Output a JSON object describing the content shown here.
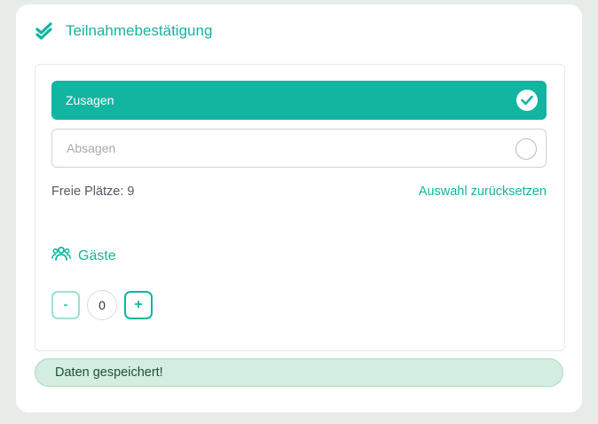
{
  "header": {
    "title": "Teilnahmebestätigung",
    "icon": "double-check-icon"
  },
  "options": {
    "accept_label": "Zusagen",
    "decline_label": "Absagen",
    "selected": "Zusagen"
  },
  "info": {
    "free_seats": "Freie Plätze: 9",
    "reset_label": "Auswahl zurücksetzen"
  },
  "guests": {
    "title": "Gäste",
    "icon": "users-icon",
    "minus_label": "-",
    "plus_label": "+",
    "count": "0"
  },
  "status": {
    "message": "Daten gespeichert!"
  },
  "colors": {
    "accent": "#12b5a0",
    "success_bg": "#d3ede0",
    "success_text": "#1f5233",
    "page_bg": "#e8ece9"
  }
}
